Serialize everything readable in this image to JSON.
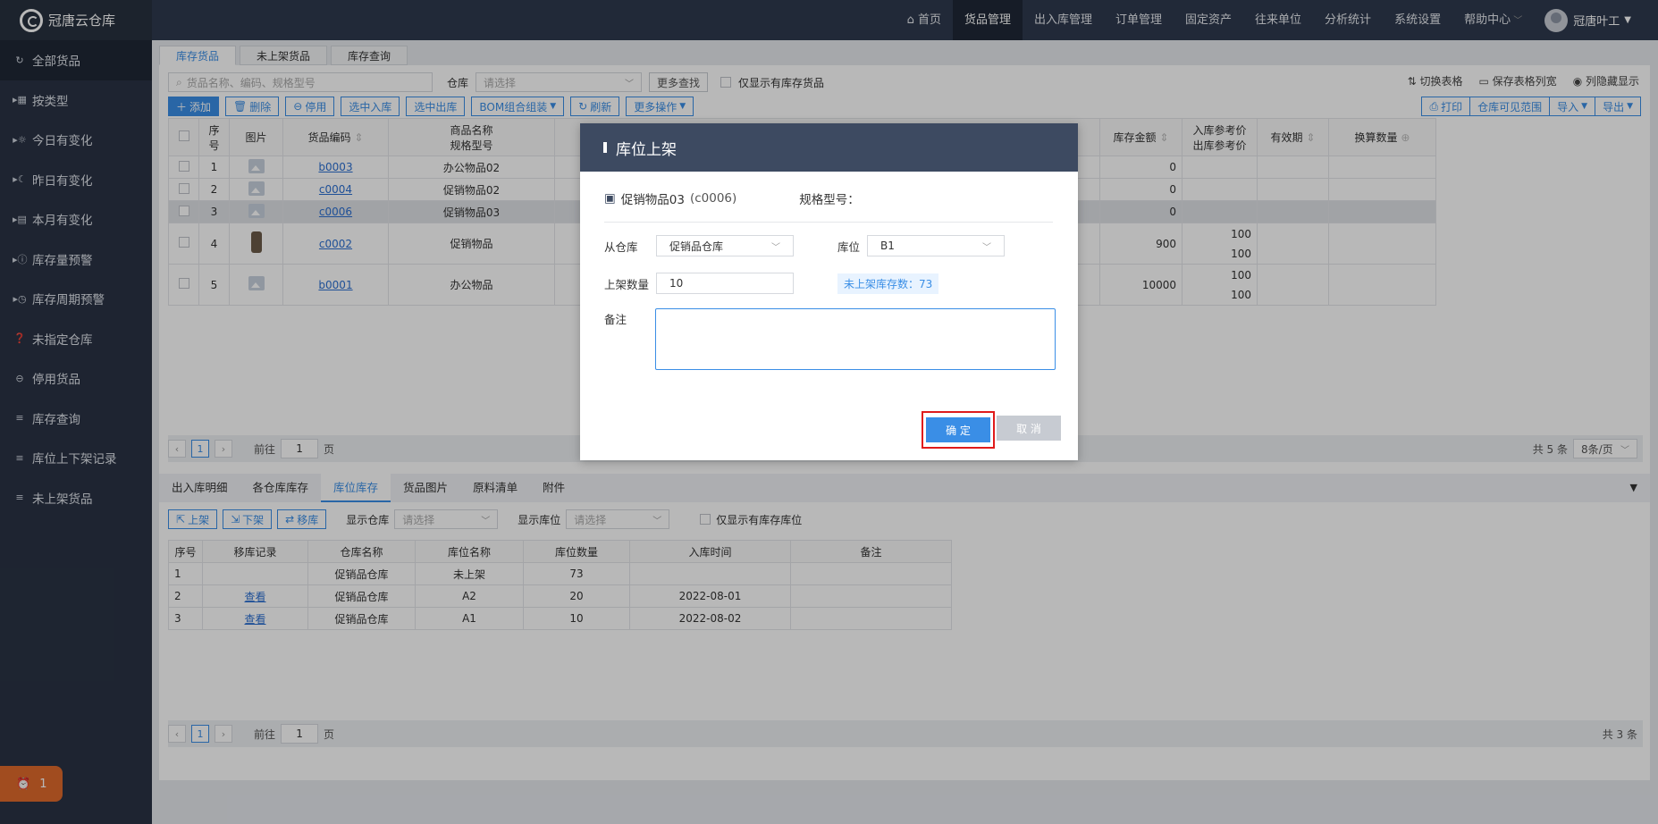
{
  "app": {
    "name": "冠唐云仓库"
  },
  "nav": {
    "items": [
      "首页",
      "货品管理",
      "出入库管理",
      "订单管理",
      "固定资产",
      "往来单位",
      "分析统计",
      "系统设置",
      "帮助中心"
    ],
    "user": "冠唐叶工"
  },
  "sidebar": {
    "items": [
      "全部货品",
      "按类型",
      "今日有变化",
      "昨日有变化",
      "本月有变化",
      "库存量预警",
      "库存周期预警",
      "未指定仓库",
      "停用货品",
      "库存查询",
      "库位上下架记录",
      "未上架货品"
    ],
    "alarm_count": "1"
  },
  "tabs": [
    "库存货品",
    "未上架货品",
    "库存查询"
  ],
  "filter": {
    "search_placeholder": "货品名称、编码、规格型号",
    "warehouse_label": "仓库",
    "warehouse_placeholder": "请选择",
    "more_search": "更多查找",
    "only_stock": "仅显示有库存货品"
  },
  "right_links": [
    "切换表格",
    "保存表格列宽",
    "列隐藏显示"
  ],
  "toolbar": {
    "add": "添加",
    "delete": "删除",
    "disable": "停用",
    "select_in": "选中入库",
    "select_out": "选中出库",
    "bom": "BOM组合组装",
    "refresh": "刷新",
    "more_ops": "更多操作",
    "print": "打印",
    "wh_visible": "仓库可见范围",
    "import": "导入",
    "export": "导出"
  },
  "goods_table": {
    "headers": [
      "序号",
      "图片",
      "货品编码",
      "商品名称",
      "规格型号",
      "库存金额",
      "入库参考价",
      "出库参考价",
      "有效期",
      "换算数量"
    ],
    "rows": [
      {
        "no": "1",
        "code": "b0003",
        "name": "办公物品02",
        "amount": "0",
        "in": "",
        "out": ""
      },
      {
        "no": "2",
        "code": "c0004",
        "name": "促销物品02",
        "amount": "0",
        "in": "",
        "out": ""
      },
      {
        "no": "3",
        "code": "c0006",
        "name": "促销物品03",
        "amount": "0",
        "in": "",
        "out": ""
      },
      {
        "no": "4",
        "code": "c0002",
        "name": "促销物品",
        "amount": "900",
        "in": "100",
        "out": "100"
      },
      {
        "no": "5",
        "code": "b0001",
        "name": "办公物品",
        "amount": "10000",
        "in": "100",
        "out": "100"
      }
    ]
  },
  "pager1": {
    "page": "1",
    "goto": "前往",
    "unit": "页",
    "total": "共 5 条",
    "size": "8条/页"
  },
  "bottom_tabs": [
    "出入库明细",
    "各仓库库存",
    "库位库存",
    "货品图片",
    "原料清单",
    "附件"
  ],
  "loc_toolbar": {
    "up": "上架",
    "down": "下架",
    "move": "移库",
    "show_wh": "显示仓库",
    "show_loc": "显示库位",
    "placeholder": "请选择",
    "only_stock": "仅显示有库存库位"
  },
  "loc_table": {
    "headers": [
      "序号",
      "移库记录",
      "仓库名称",
      "库位名称",
      "库位数量",
      "入库时间",
      "备注"
    ],
    "rows": [
      [
        "1",
        "",
        "促销品仓库",
        "未上架",
        "73",
        "",
        ""
      ],
      [
        "2",
        "查看",
        "促销品仓库",
        "A2",
        "20",
        "2022-08-01",
        ""
      ],
      [
        "3",
        "查看",
        "促销品仓库",
        "A1",
        "10",
        "2022-08-02",
        ""
      ]
    ]
  },
  "pager2": {
    "page": "1",
    "goto": "前往",
    "unit": "页",
    "total": "共 3 条"
  },
  "modal": {
    "title": "库位上架",
    "item": "促销物品03",
    "item_code": "(c0006)",
    "spec_label": "规格型号：",
    "from_wh_label": "从仓库",
    "from_wh": "促销品仓库",
    "loc_label": "库位",
    "loc": "B1",
    "qty_label": "上架数量",
    "qty": "10",
    "hint": "未上架库存数：73",
    "remark_label": "备注",
    "ok": "确 定",
    "cancel": "取 消"
  }
}
